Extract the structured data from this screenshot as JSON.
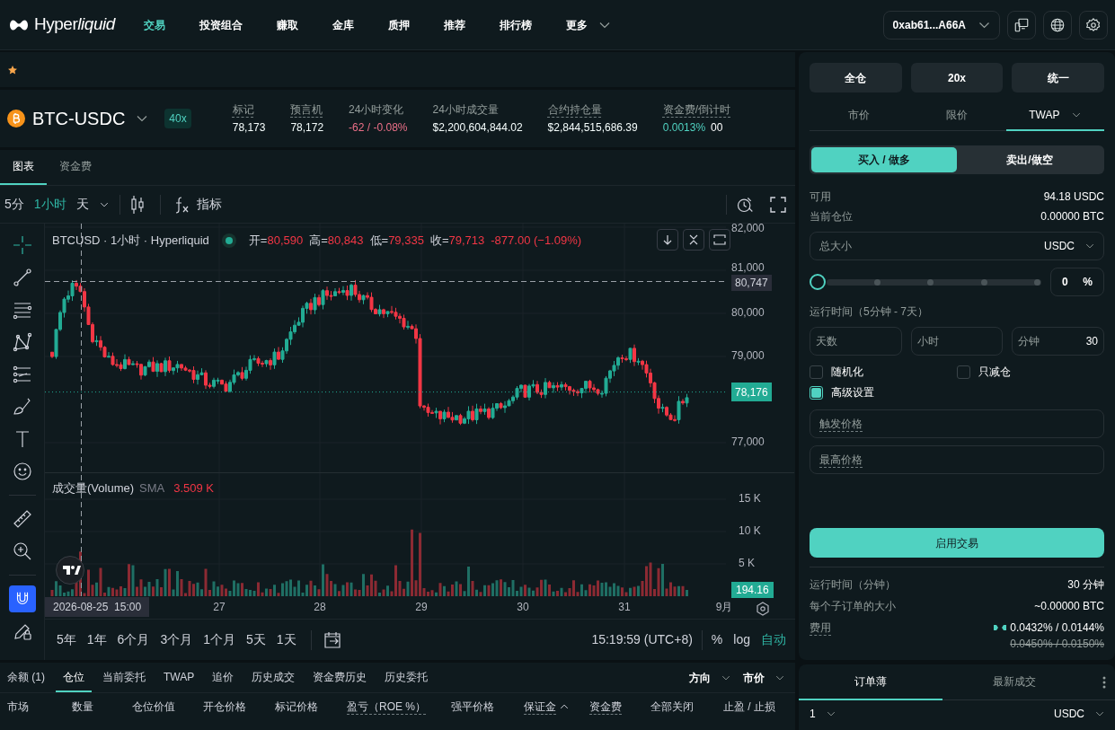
{
  "nav": {
    "brand": "Hyper",
    "brand_italic": "liquid",
    "items": [
      {
        "label": "交易",
        "selected": true
      },
      {
        "label": "投资组合",
        "selected": false
      },
      {
        "label": "赚取",
        "selected": false
      },
      {
        "label": "金库",
        "selected": false
      },
      {
        "label": "质押",
        "selected": false
      },
      {
        "label": "推荐",
        "selected": false
      },
      {
        "label": "排行榜",
        "selected": false
      },
      {
        "label": "更多",
        "selected": false,
        "dropdown": true
      }
    ],
    "wallet": "0xab61...A66A"
  },
  "market": {
    "symbol": "BTC-USDC",
    "leverage": "40x",
    "stats": [
      {
        "label": "标记",
        "underlined": true,
        "value": "78,173",
        "color": "#f6fefd"
      },
      {
        "label": "预言机",
        "underlined": true,
        "value": "78,172",
        "color": "#f6fefd"
      },
      {
        "label": "24小时变化",
        "underlined": false,
        "value": "-62 / -0.08%",
        "color": "#ed7088"
      },
      {
        "label": "24小时成交量",
        "underlined": false,
        "value": "$2,200,604,844.02",
        "color": "#f6fefd"
      },
      {
        "label": "合约持仓量",
        "underlined": true,
        "value": "$2,844,515,686.39",
        "color": "#f6fefd"
      },
      {
        "label": "资金费/倒计时",
        "underlined": true,
        "value": "0.0013%",
        "color": "#50d2c1",
        "countdown": "00"
      }
    ]
  },
  "chart_tabs": [
    {
      "label": "图表",
      "selected": true
    },
    {
      "label": "资金费",
      "selected": false
    }
  ],
  "toolbar": {
    "intervals": [
      {
        "label": "5分",
        "selected": false
      },
      {
        "label": "1小时",
        "selected": true
      },
      {
        "label": "天",
        "selected": false
      }
    ],
    "indicators": "指标"
  },
  "chart": {
    "legend": {
      "title": "BTCUSD · 1小时 · Hyperliquid",
      "ohlc": [
        {
          "label": "开=",
          "value": "80,590"
        },
        {
          "label": "高=",
          "value": "80,843"
        },
        {
          "label": "低=",
          "value": "79,335"
        },
        {
          "label": "收=",
          "value": "79,713"
        }
      ],
      "change": "-877.00 (−1.09%)"
    },
    "volume_legend": {
      "title": "成交量(Volume)",
      "indicator": "SMA",
      "value": "3.509 K"
    },
    "price_ticks": [
      "82,000",
      "81,000",
      "80,000",
      "79,000",
      "77,000"
    ],
    "crosshair_price": "80,747",
    "last_price": "78,176",
    "volume_ticks": [
      "15 K",
      "10 K",
      "5 K"
    ],
    "last_volume": "194.16",
    "date_ticks": [
      "27",
      "28",
      "29",
      "30",
      "31",
      "9月"
    ],
    "crosshair_time": "2026-08-25  15:00"
  },
  "ranges": [
    "5年",
    "1年",
    "6个月",
    "3个月",
    "1个月",
    "5天",
    "1天"
  ],
  "clock": "15:19:59 (UTC+8)",
  "scale_options": [
    {
      "label": "%",
      "selected": false
    },
    {
      "label": "log",
      "selected": false
    },
    {
      "label": "自动",
      "selected": true
    }
  ],
  "bottom": {
    "tabs": [
      {
        "label": "余额 (1)",
        "selected": false
      },
      {
        "label": "仓位",
        "selected": true
      },
      {
        "label": "当前委托",
        "selected": false
      },
      {
        "label": "TWAP",
        "selected": false
      },
      {
        "label": "追价",
        "selected": false
      },
      {
        "label": "历史成交",
        "selected": false
      },
      {
        "label": "资金费历史",
        "selected": false
      },
      {
        "label": "历史委托",
        "selected": false
      }
    ],
    "filters": [
      "方向",
      "市价"
    ],
    "columns": [
      {
        "label": "市场",
        "underlined": false
      },
      {
        "label": "数量",
        "underlined": false
      },
      {
        "label": "仓位价值",
        "underlined": false
      },
      {
        "label": "开仓价格",
        "underlined": false
      },
      {
        "label": "标记价格",
        "underlined": false
      },
      {
        "label": "盈亏（ROE %）",
        "underlined": true
      },
      {
        "label": "强平价格",
        "underlined": false
      },
      {
        "label": "保证金",
        "underlined": true,
        "sorted": true
      },
      {
        "label": "资金费",
        "underlined": true
      },
      {
        "label": "全部关闭",
        "underlined": false
      },
      {
        "label": "止盈 / 止损",
        "underlined": false
      }
    ]
  },
  "order": {
    "margin_buttons": [
      "全仓",
      "20x",
      "统一"
    ],
    "types": [
      {
        "label": "市价",
        "selected": false
      },
      {
        "label": "限价",
        "selected": false
      },
      {
        "label": "TWAP",
        "selected": true,
        "dropdown": true
      }
    ],
    "sides": [
      {
        "label": "买入 / 做多",
        "selected": true
      },
      {
        "label": "卖出/做空",
        "selected": false
      }
    ],
    "info": [
      {
        "label": "可用",
        "value": "94.18 USDC"
      },
      {
        "label": "当前仓位",
        "value": "0.00000 BTC"
      }
    ],
    "size": {
      "placeholder": "总大小",
      "unit": "USDC"
    },
    "slider": {
      "level": 0
    },
    "percent": {
      "value": "0",
      "unit": "%"
    },
    "duration_label": "运行时间（5分钟 - 7天）",
    "duration_fields": [
      {
        "label": "天数"
      },
      {
        "label": "小时"
      },
      {
        "label": "分钟",
        "value": "30"
      }
    ],
    "options": [
      {
        "label": "随机化",
        "checked": false
      },
      {
        "label": "只减仓",
        "checked": false
      },
      {
        "label": "高级设置",
        "checked": true
      }
    ],
    "price_fields": [
      {
        "placeholder": "触发价格"
      },
      {
        "placeholder": "最高价格"
      }
    ],
    "submit": "启用交易",
    "summary": [
      {
        "label": "运行时间（分钟）",
        "underlined": false,
        "value": "30 分钟"
      },
      {
        "label": "每个子订单的大小",
        "underlined": false,
        "value": "~0.00000 BTC"
      },
      {
        "label": "费用",
        "underlined": true,
        "value": "0.0432% / 0.0144%",
        "old_value": "0.0450% / 0.0150%"
      }
    ]
  },
  "orderbook": {
    "tabs": [
      {
        "label": "订单薄",
        "selected": true
      },
      {
        "label": "最新成交",
        "selected": false
      }
    ],
    "precision": "1",
    "unit": "USDC"
  }
}
